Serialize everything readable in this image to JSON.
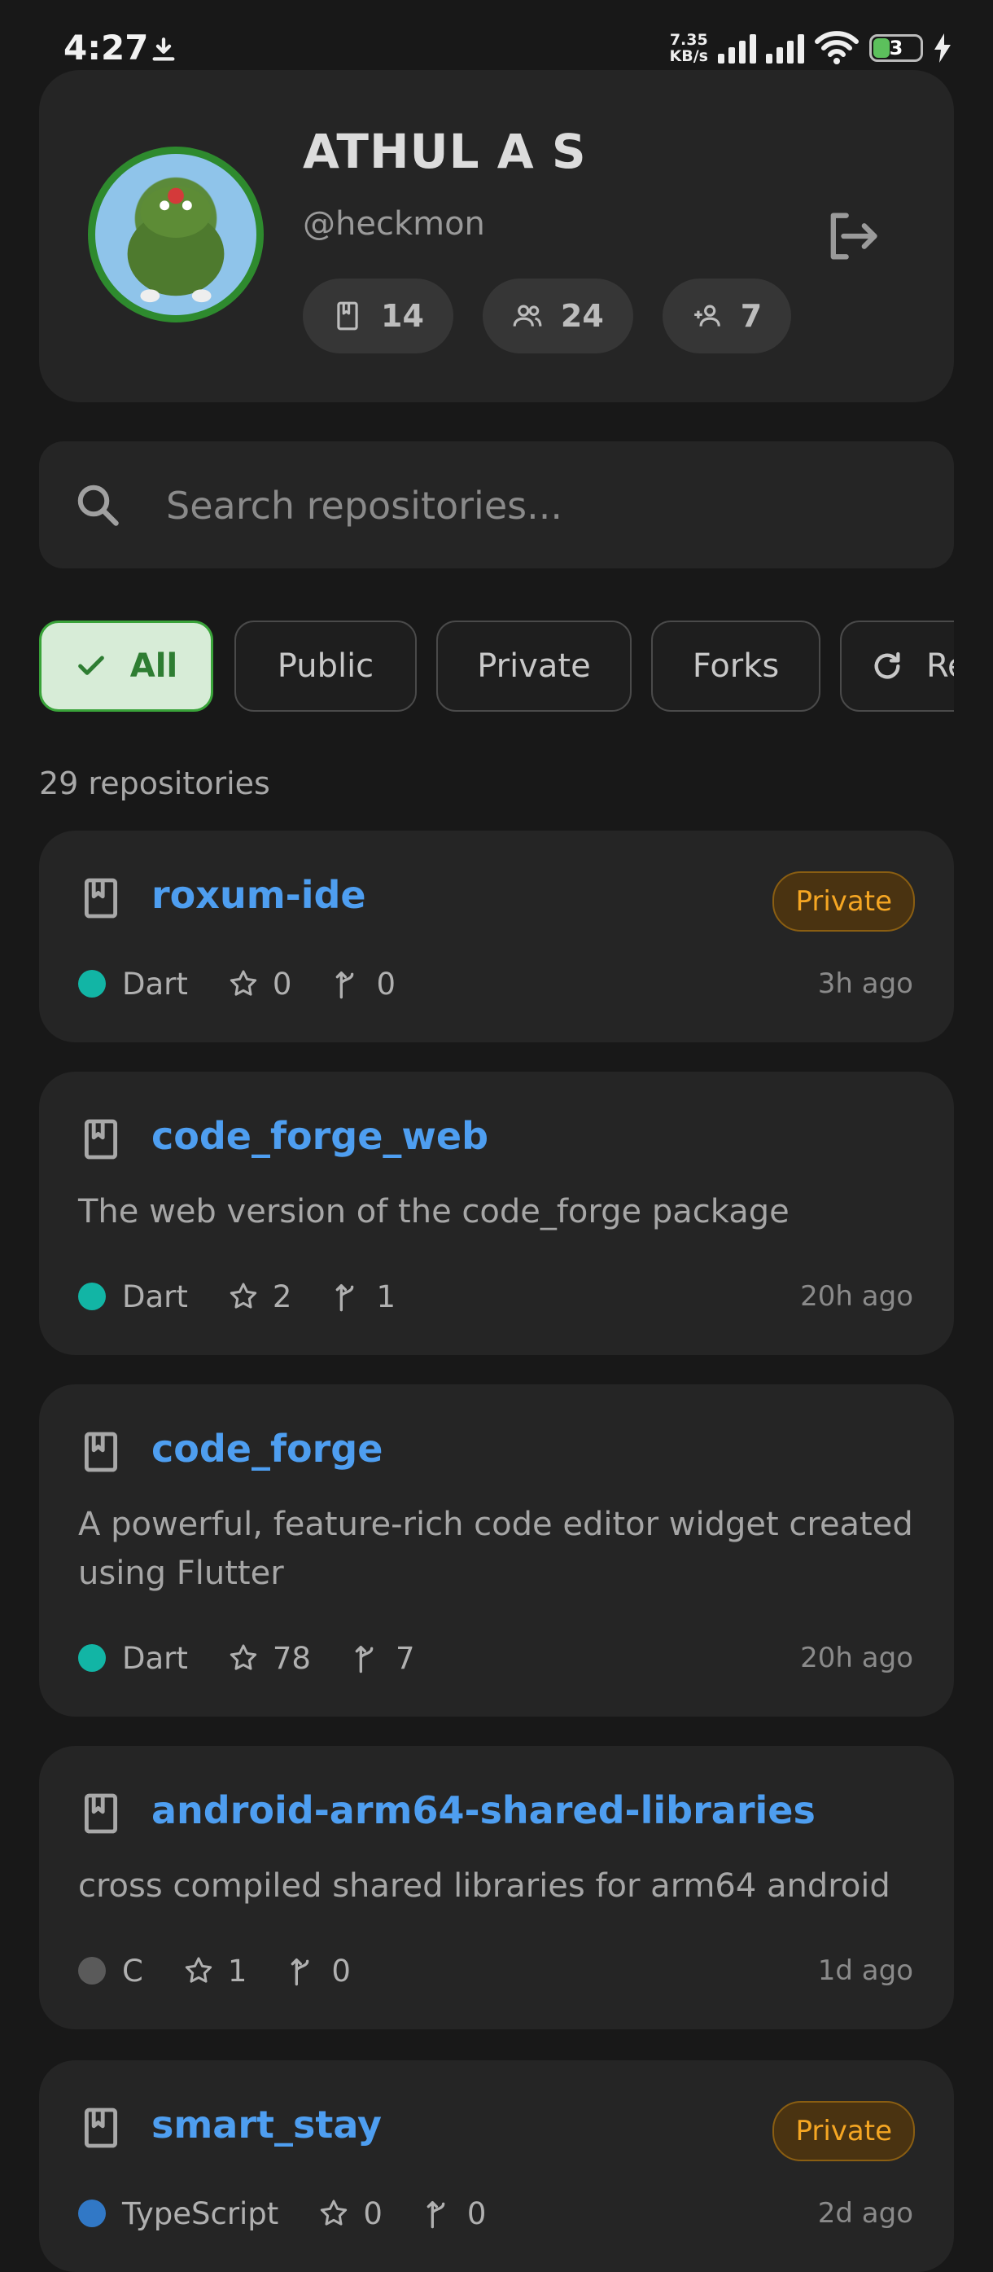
{
  "status_bar": {
    "time": "4:27",
    "speed_value": "7.35",
    "speed_unit": "KB/s",
    "battery": "3"
  },
  "profile": {
    "name": "ATHUL A S",
    "handle": "@heckmon",
    "stats": {
      "repos": "14",
      "followers": "24",
      "following": "7"
    }
  },
  "search": {
    "placeholder": "Search repositories..."
  },
  "filters": [
    "All",
    "Public",
    "Private",
    "Forks",
    "Refresh"
  ],
  "repo_count": "29 repositories",
  "repos": [
    {
      "name": "roxum-ide",
      "badge": "Private",
      "description": "",
      "language": "Dart",
      "lang_color": "#12b5a5",
      "stars": "0",
      "forks": "0",
      "updated": "3h ago"
    },
    {
      "name": "code_forge_web",
      "badge": "",
      "description": "The web version of the code_forge package",
      "language": "Dart",
      "lang_color": "#12b5a5",
      "stars": "2",
      "forks": "1",
      "updated": "20h ago"
    },
    {
      "name": "code_forge",
      "badge": "",
      "description": "A powerful, feature-rich code editor widget created using Flutter",
      "language": "Dart",
      "lang_color": "#12b5a5",
      "stars": "78",
      "forks": "7",
      "updated": "20h ago"
    },
    {
      "name": "android-arm64-shared-libraries",
      "badge": "",
      "description": "cross compiled shared libraries for arm64 android",
      "language": "C",
      "lang_color": "#5a5a5a",
      "stars": "1",
      "forks": "0",
      "updated": "1d ago"
    },
    {
      "name": "smart_stay",
      "badge": "Private",
      "description": "",
      "language": "TypeScript",
      "lang_color": "#3178c6",
      "stars": "0",
      "forks": "0",
      "updated": "2d ago"
    }
  ]
}
